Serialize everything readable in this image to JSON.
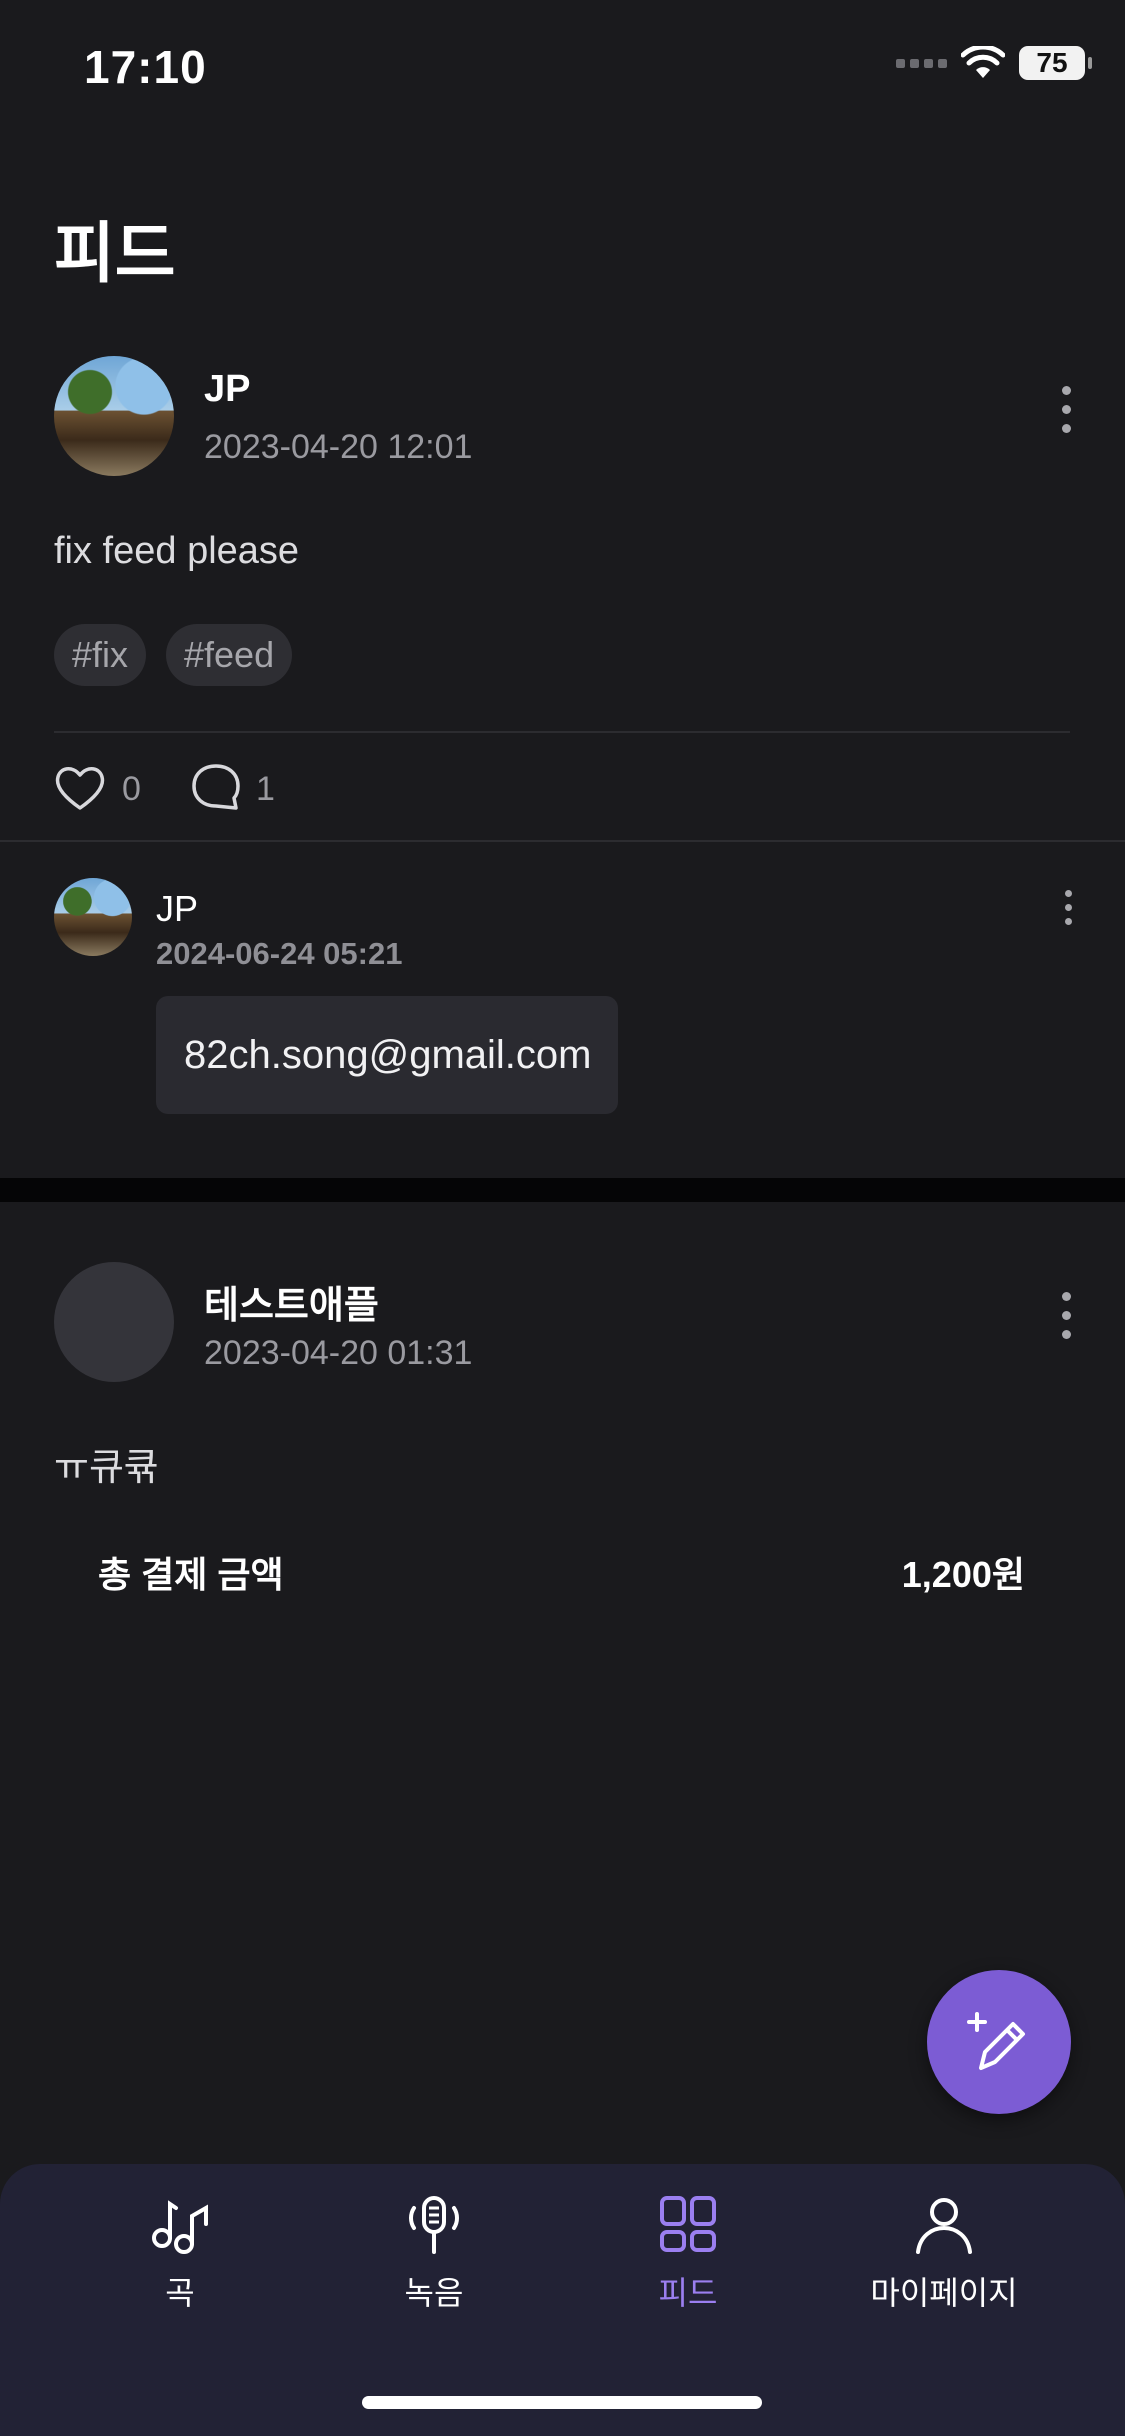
{
  "status_bar": {
    "time": "17:10",
    "battery": "75"
  },
  "page_title": "피드",
  "posts": [
    {
      "username": "JP",
      "timestamp": "2023-04-20 12:01",
      "text": "fix feed please",
      "tags": [
        "#fix",
        "#feed"
      ],
      "likes": "0",
      "comments": "1",
      "comment_list": [
        {
          "username": "JP",
          "timestamp": "2024-06-24 05:21",
          "text": "82ch.song@gmail.com"
        }
      ]
    },
    {
      "username": "테스트애플",
      "timestamp": "2023-04-20 01:31",
      "text": "ㅠ큐큒",
      "total_label": "총 결제 금액",
      "total_value": "1,200원"
    }
  ],
  "tabbar": {
    "items": [
      {
        "label": "곡",
        "icon": "music-note-icon",
        "active": false
      },
      {
        "label": "녹음",
        "icon": "microphone-icon",
        "active": false
      },
      {
        "label": "피드",
        "icon": "grid-icon",
        "active": true
      },
      {
        "label": "마이페이지",
        "icon": "person-icon",
        "active": false
      }
    ]
  },
  "colors": {
    "background": "#1a1a1d",
    "accent": "#7c5cd4",
    "tabbar_bg": "#222235"
  }
}
